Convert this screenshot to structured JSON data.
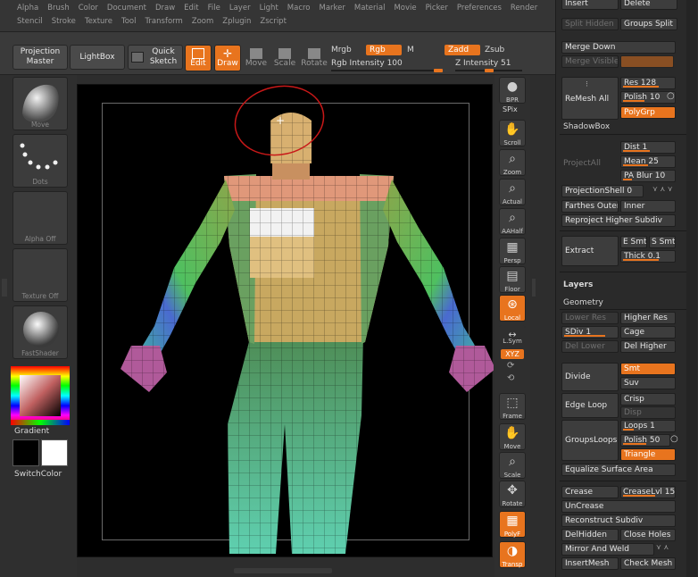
{
  "menu": {
    "row1": [
      "Alpha",
      "Brush",
      "Color",
      "Document",
      "Draw",
      "Edit",
      "File",
      "Layer",
      "Light",
      "Macro",
      "Marker",
      "Material",
      "Movie",
      "Picker",
      "Preferences",
      "Render"
    ],
    "row2": [
      "Stencil",
      "Stroke",
      "Texture",
      "Tool",
      "Transform",
      "Zoom",
      "Zplugin",
      "Zscript"
    ]
  },
  "toolbar": {
    "projection_master": "Projection Master",
    "lightbox": "LightBox",
    "quick_sketch": "Quick Sketch",
    "edit": "Edit",
    "draw": "Draw",
    "move": "Move",
    "scale": "Scale",
    "rotate": "Rotate",
    "mrgb": "Mrgb",
    "rgb": "Rgb",
    "m": "M",
    "zadd": "Zadd",
    "zsub": "Zsub",
    "rgb_intensity": "Rgb Intensity 100",
    "z_intensity": "Z Intensity 51",
    "rgb_intensity_level": 1.0,
    "z_intensity_level": 0.51
  },
  "left_shelf": {
    "brush": "Move",
    "stroke": "Dots",
    "alpha": "Alpha Off",
    "texture": "Texture Off",
    "material": "FastShader",
    "gradient": "Gradient",
    "switch_color": "SwitchColor",
    "main_color": "#000000",
    "secondary_color": "#ffffff"
  },
  "right_shelf": {
    "bpr": "BPR",
    "spix": "SPix",
    "scroll": "Scroll",
    "zoom": "Zoom",
    "actual": "Actual",
    "aahalf": "AAHalf",
    "persp": "Persp",
    "floor": "Floor",
    "local": "Local",
    "lsym": "L.Sym",
    "xyz": "XYZ",
    "frame": "Frame",
    "move": "Move",
    "scale": "Scale",
    "rotate": "Rotate",
    "polyf": "PolyF",
    "transp": "Transp"
  },
  "panel": {
    "insert": "Insert",
    "delete": "Delete",
    "split_hidden": "Split Hidden",
    "groups_split": "Groups Split",
    "merge_down": "Merge Down",
    "merge_visible": "Merge Visible",
    "remesh_all": "ReMesh All",
    "res": "Res 128",
    "polish": "Polish 10",
    "polygrp": "PolyGrp",
    "shadowbox": "ShadowBox",
    "project_all": "ProjectAll",
    "dist": "Dist 1",
    "mean": "Mean 25",
    "pa_blur": "PA Blur 10",
    "projection_shell": "ProjectionShell 0",
    "farthest": "Farthes",
    "outer": "Outer",
    "inner": "Inner",
    "reproject": "Reproject Higher Subdiv",
    "extract": "Extract",
    "e_smt": "E Smt",
    "s_smt": "S Smt",
    "thick": "Thick 0.1",
    "layers": "Layers",
    "geometry": "Geometry",
    "lower_res": "Lower Res",
    "higher_res": "Higher Res",
    "sdiv": "SDiv 1",
    "cage": "Cage",
    "del_lower": "Del Lower",
    "del_higher": "Del Higher",
    "divide": "Divide",
    "smt": "Smt",
    "suv": "Suv",
    "edge_loop": "Edge Loop",
    "crisp": "Crisp",
    "disp": "Disp",
    "groups_loops": "GroupsLoops",
    "loops": "Loops 1",
    "polish2": "Polish 50",
    "triangle": "Triangle",
    "equalize": "Equalize Surface Area",
    "crease": "Crease",
    "crease_lvl": "CreaseLvl 15",
    "uncrease": "UnCrease",
    "reconstruct": "Reconstruct Subdiv",
    "del_hidden": "DelHidden",
    "close_holes": "Close Holes",
    "mirror_weld": "Mirror And Weld",
    "insert_mesh": "InsertMesh",
    "check_mesh": "Check Mesh"
  }
}
